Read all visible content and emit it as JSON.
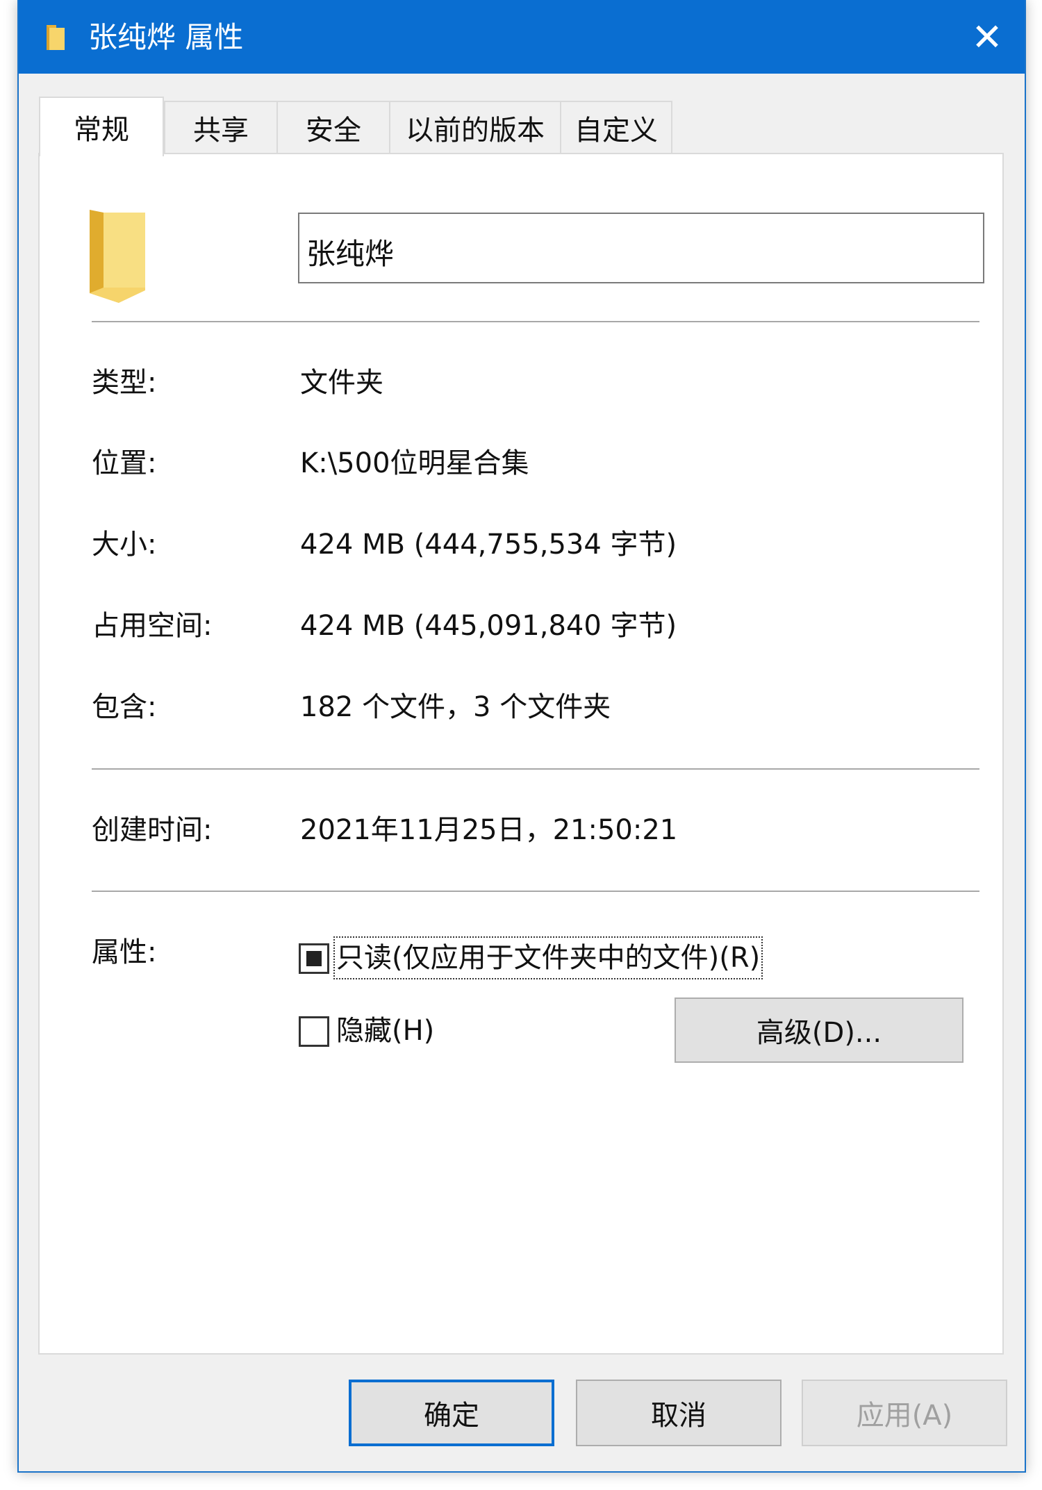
{
  "window": {
    "title": "张纯烨 属性",
    "close_symbol": "✕",
    "titlebar_color": "#0a6ed1"
  },
  "tabs": [
    {
      "label": "常规",
      "active": true
    },
    {
      "label": "共享",
      "active": false
    },
    {
      "label": "安全",
      "active": false
    },
    {
      "label": "以前的版本",
      "active": false
    },
    {
      "label": "自定义",
      "active": false
    }
  ],
  "general": {
    "folder_name": "张纯烨",
    "icon": "folder-icon",
    "type_label": "类型:",
    "type_value": "文件夹",
    "location_label": "位置:",
    "location_value": "K:\\500位明星合集",
    "size_label": "大小:",
    "size_value": "424 MB (444,755,534 字节)",
    "disk_size_label": "占用空间:",
    "disk_size_value": "424 MB (445,091,840 字节)",
    "contains_label": "包含:",
    "contains_value": "182 个文件，3 个文件夹",
    "created_label": "创建时间:",
    "created_value": "2021年11月25日，21:50:21",
    "attributes_label": "属性:",
    "readonly_label": "只读(仅应用于文件夹中的文件)(R)",
    "readonly_state": "indeterminate",
    "hidden_label": "隐藏(H)",
    "hidden_checked": false,
    "advanced_label": "高级(D)..."
  },
  "footer": {
    "ok_label": "确定",
    "cancel_label": "取消",
    "apply_label": "应用(A)"
  }
}
